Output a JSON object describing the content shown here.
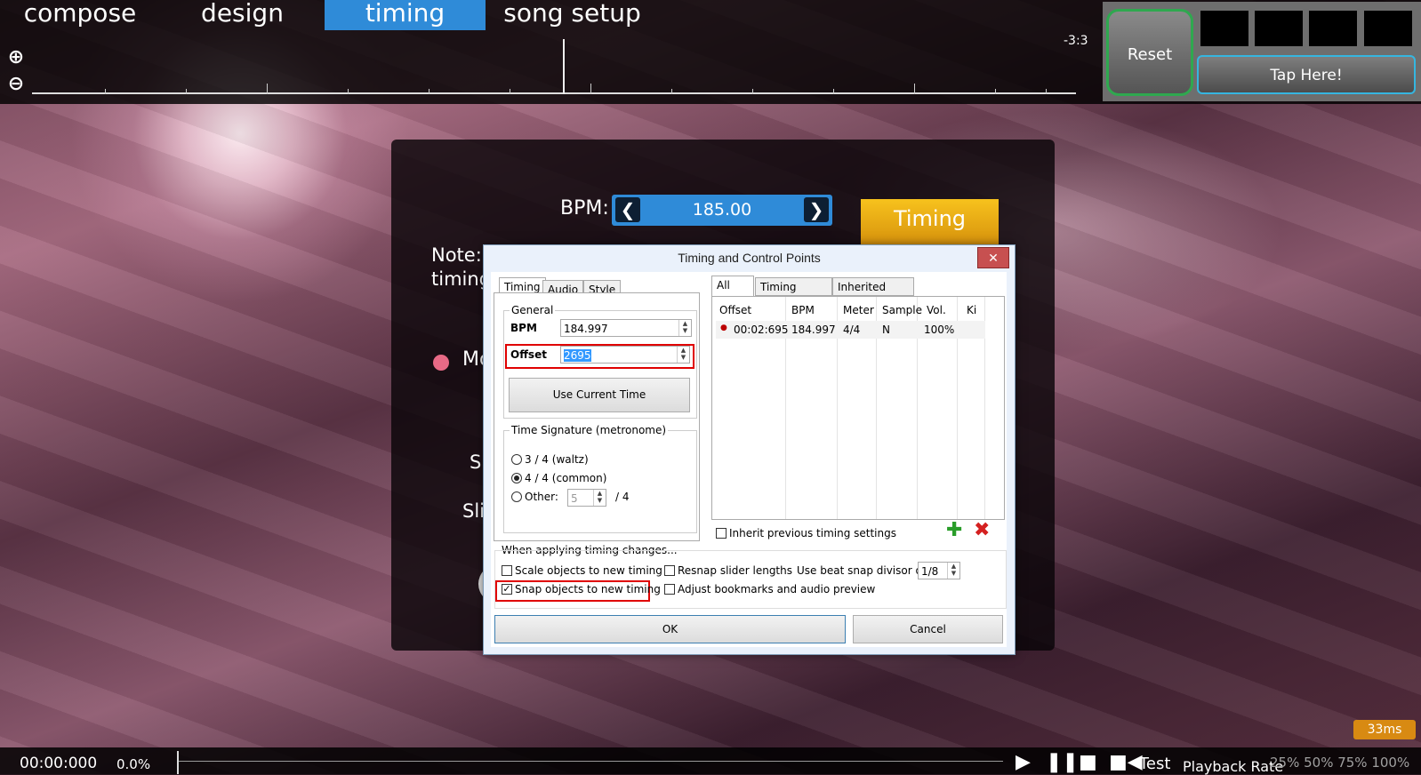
{
  "tabs": [
    "compose",
    "design",
    "timing",
    "song setup"
  ],
  "active_tab": "timing",
  "timeline": {
    "time_remaining": "-3:3"
  },
  "tap_panel": {
    "reset_label": "Reset",
    "tap_label": "Tap Here!"
  },
  "timing_panel": {
    "bpm_label": "BPM:",
    "bpm_value": "185.00",
    "timing_setup_label": "Timing Setup",
    "note_line1": "Note:",
    "note_line2": "timing",
    "partial_label": "Mo",
    "partial_s1": "Sl",
    "partial_s2": "Sli"
  },
  "dialog": {
    "title": "Timing and Control Points",
    "close_label": "✕",
    "left_tabs": [
      "Timing",
      "Audio",
      "Style"
    ],
    "general_label": "General",
    "bpm_label": "BPM",
    "bpm_value": "184.997",
    "offset_label": "Offset",
    "offset_value": "2695",
    "use_current_time": "Use Current Time",
    "time_signature_label": "Time Signature (metronome)",
    "sig_options": [
      "3 / 4 (waltz)",
      "4 / 4 (common)",
      "Other:"
    ],
    "other_value": "5",
    "other_suffix": "/ 4",
    "right_tabs": [
      "All",
      "Timing Points",
      "Inherited Points"
    ],
    "columns": [
      "Offset",
      "BPM",
      "Meter",
      "Sample",
      "Vol.",
      "Ki"
    ],
    "rows": [
      {
        "offset": "00:02:695",
        "bpm": "184.997",
        "meter": "4/4",
        "sample": "N",
        "vol": "100%"
      }
    ],
    "inherit_label": "Inherit previous timing settings",
    "applying_label": "When applying timing changes...",
    "scale_label": "Scale objects to new timing",
    "snap_label": "Snap objects to new timing",
    "resnap_label": "Resnap slider lengths",
    "adjust_label": "Adjust bookmarks and audio preview",
    "beat_snap_label": "Use beat snap divisor of",
    "beat_snap_value": "1/8",
    "ok_label": "OK",
    "cancel_label": "Cancel"
  },
  "bottom": {
    "time": "00:00:000",
    "percent": "0.0%",
    "test_label": "Test",
    "playback_rate_label": "Playback Rate",
    "rates": "25% 50% 75% 100%",
    "latency": "33ms"
  }
}
